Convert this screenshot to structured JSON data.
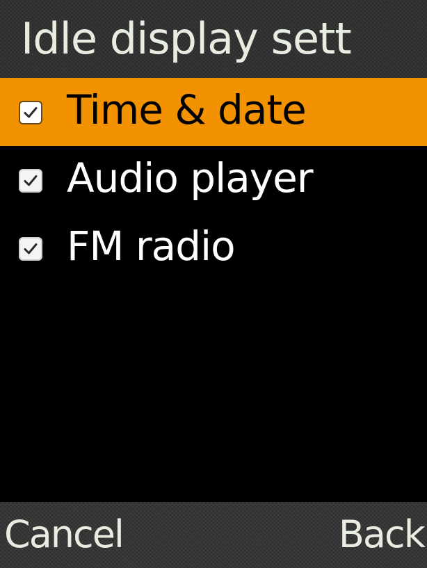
{
  "header": {
    "title": "Idle display sett"
  },
  "list": {
    "items": [
      {
        "label": "Time & date",
        "checked": true,
        "selected": true
      },
      {
        "label": "Audio player",
        "checked": true,
        "selected": false
      },
      {
        "label": "FM radio",
        "checked": true,
        "selected": false
      }
    ]
  },
  "softkeys": {
    "left_label": "Cancel",
    "right_label": "Back"
  },
  "colors": {
    "selection": "#f29200",
    "background": "#000000",
    "bar": "#2b2b2b",
    "bar_text": "#e8ede2"
  },
  "icons": {
    "checkbox": "checkbox-checked-icon"
  }
}
